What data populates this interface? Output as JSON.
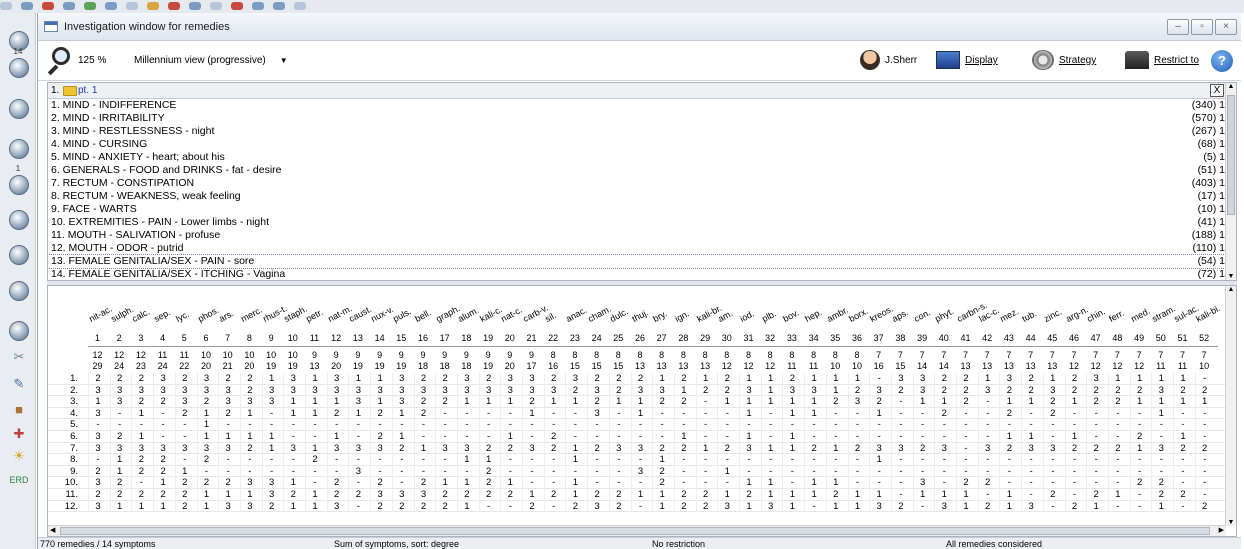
{
  "window": {
    "title": "Investigation window for remedies"
  },
  "sidebar": {
    "numbers": [
      "14",
      "1"
    ]
  },
  "toolbar": {
    "zoom": "125 %",
    "view_mode": "Millennium view (progressive)",
    "author": "J.Sherr",
    "display": "Display",
    "strategy": "Strategy",
    "restrict": "Restrict to",
    "help": "?"
  },
  "rubrics_pane": {
    "header_number": "1.",
    "header_title": "pt. 1",
    "close": "X",
    "items": [
      {
        "label": "1. MIND - INDIFFERENCE",
        "count": "(340) 1"
      },
      {
        "label": "2. MIND - IRRITABILITY",
        "count": "(570) 1"
      },
      {
        "label": "3. MIND - RESTLESSNESS - night",
        "count": "(267) 1"
      },
      {
        "label": "4. MIND - CURSING",
        "count": "(68) 1"
      },
      {
        "label": "5. MIND - ANXIETY - heart; about his",
        "count": "(5) 1"
      },
      {
        "label": "6. GENERALS - FOOD and DRINKS - fat - desire",
        "count": "(51) 1"
      },
      {
        "label": "7. RECTUM - CONSTIPATION",
        "count": "(403) 1"
      },
      {
        "label": "8. RECTUM - WEAKNESS, weak feeling",
        "count": "(17) 1"
      },
      {
        "label": "9. FACE - WARTS",
        "count": "(10) 1"
      },
      {
        "label": "10. EXTREMITIES - PAIN - Lower limbs - night",
        "count": "(41) 1"
      },
      {
        "label": "11. MOUTH - SALIVATION - profuse",
        "count": "(188) 1"
      },
      {
        "label": "12. MOUTH - ODOR - putrid",
        "count": "(110) 1"
      },
      {
        "label": "13. FEMALE GENITALIA/SEX - PAIN - sore",
        "count": "(54) 1"
      },
      {
        "label": "14. FEMALE GENITALIA/SEX - ITCHING - Vagina",
        "count": "(72) 1"
      }
    ]
  },
  "grid": {
    "remedies": [
      "nit-ac.",
      "sulph.",
      "calc.",
      "sep.",
      "lyc.",
      "phos.",
      "ars.",
      "merc.",
      "rhus-t.",
      "staph.",
      "petr.",
      "nat-m.",
      "caust.",
      "nux-v.",
      "puls.",
      "bell.",
      "graph.",
      "alum.",
      "kali-c.",
      "nat-c.",
      "carb-v.",
      "sil.",
      "anac.",
      "cham.",
      "dulc.",
      "thuj.",
      "bry.",
      "ign.",
      "kali-br.",
      "am.",
      "iod.",
      "plb.",
      "bov.",
      "hep.",
      "ambr.",
      "borx.",
      "kreos.",
      "aps.",
      "con.",
      "phyt.",
      "carbn-s.",
      "lac-c.",
      "mez.",
      "tub.",
      "zinc.",
      "arg-n.",
      "chin.",
      "ferr.",
      "med.",
      "stram.",
      "sul-ac.",
      "kali-bi."
    ],
    "indices": [
      "1",
      "2",
      "3",
      "4",
      "5",
      "6",
      "7",
      "8",
      "9",
      "10",
      "11",
      "12",
      "13",
      "14",
      "15",
      "16",
      "17",
      "18",
      "19",
      "20",
      "21",
      "22",
      "23",
      "24",
      "25",
      "26",
      "27",
      "28",
      "29",
      "30",
      "31",
      "32",
      "33",
      "34",
      "35",
      "36",
      "37",
      "38",
      "39",
      "40",
      "41",
      "42",
      "43",
      "44",
      "45",
      "46",
      "47",
      "48",
      "49",
      "50",
      "51",
      "52"
    ],
    "totals_row1": [
      "12",
      "12",
      "12",
      "11",
      "11",
      "10",
      "10",
      "10",
      "10",
      "10",
      "9",
      "9",
      "9",
      "9",
      "9",
      "9",
      "9",
      "9",
      "9",
      "9",
      "9",
      "8",
      "8",
      "8",
      "8",
      "8",
      "8",
      "8",
      "8",
      "8",
      "8",
      "8",
      "8",
      "8",
      "8",
      "8",
      "7",
      "7",
      "7",
      "7",
      "7",
      "7",
      "7",
      "7",
      "7",
      "7",
      "7",
      "7",
      "7",
      "7",
      "7",
      "7"
    ],
    "totals_row2": [
      "29",
      "24",
      "23",
      "24",
      "22",
      "20",
      "21",
      "20",
      "19",
      "19",
      "13",
      "20",
      "19",
      "19",
      "19",
      "18",
      "18",
      "18",
      "19",
      "20",
      "17",
      "16",
      "15",
      "15",
      "15",
      "13",
      "13",
      "13",
      "13",
      "12",
      "12",
      "12",
      "11",
      "11",
      "10",
      "10",
      "16",
      "15",
      "14",
      "14",
      "13",
      "13",
      "13",
      "13",
      "13",
      "12",
      "12",
      "12",
      "12",
      "11",
      "11",
      "10"
    ],
    "rows": [
      {
        "label": "1.",
        "cells": [
          "2",
          "2",
          "2",
          "3",
          "2",
          "3",
          "2",
          "2",
          "1",
          "3",
          "1",
          "3",
          "1",
          "1",
          "3",
          "2",
          "2",
          "3",
          "2",
          "3",
          "3",
          "2",
          "3",
          "2",
          "2",
          "2",
          "1",
          "2",
          "1",
          "2",
          "1",
          "1",
          "2",
          "1",
          "1",
          "1",
          "-",
          "3",
          "3",
          "2",
          "2",
          "1",
          "3",
          "2",
          "1",
          "2",
          "3",
          "1",
          "1",
          "1",
          "1",
          "-"
        ]
      },
      {
        "label": "2.",
        "cells": [
          "3",
          "3",
          "3",
          "3",
          "3",
          "3",
          "3",
          "2",
          "3",
          "3",
          "3",
          "3",
          "3",
          "3",
          "3",
          "3",
          "3",
          "3",
          "3",
          "3",
          "3",
          "3",
          "2",
          "3",
          "2",
          "3",
          "3",
          "1",
          "2",
          "2",
          "3",
          "1",
          "3",
          "3",
          "1",
          "2",
          "3",
          "2",
          "3",
          "2",
          "2",
          "3",
          "2",
          "2",
          "3",
          "2",
          "2",
          "2",
          "2",
          "3",
          "2",
          "2"
        ]
      },
      {
        "label": "3.",
        "cells": [
          "1",
          "3",
          "2",
          "2",
          "3",
          "2",
          "3",
          "3",
          "3",
          "1",
          "1",
          "1",
          "3",
          "1",
          "3",
          "2",
          "2",
          "1",
          "1",
          "1",
          "2",
          "1",
          "1",
          "2",
          "1",
          "1",
          "2",
          "2",
          "-",
          "1",
          "1",
          "1",
          "1",
          "1",
          "2",
          "3",
          "2",
          "-",
          "1",
          "1",
          "2",
          "-",
          "1",
          "1",
          "2",
          "1",
          "2",
          "2",
          "1",
          "1",
          "1",
          "1"
        ]
      },
      {
        "label": "4.",
        "cells": [
          "3",
          "-",
          "1",
          "-",
          "2",
          "1",
          "2",
          "1",
          "-",
          "1",
          "1",
          "2",
          "1",
          "2",
          "1",
          "2",
          "-",
          "-",
          "-",
          "-",
          "1",
          "-",
          "-",
          "3",
          "-",
          "1",
          "-",
          "-",
          "-",
          "-",
          "1",
          "-",
          "1",
          "1",
          "-",
          "-",
          "1",
          "-",
          "-",
          "2",
          "-",
          "-",
          "2",
          "-",
          "2",
          "-",
          "-",
          "-",
          "-",
          "1",
          "-",
          "-"
        ]
      },
      {
        "label": "5.",
        "cells": [
          "-",
          "-",
          "-",
          "-",
          "-",
          "1",
          "-",
          "-",
          "-",
          "-",
          "-",
          "-",
          "-",
          "-",
          "-",
          "-",
          "-",
          "-",
          "-",
          "-",
          "-",
          "-",
          "-",
          "-",
          "-",
          "-",
          "-",
          "-",
          "-",
          "-",
          "-",
          "-",
          "-",
          "-",
          "-",
          "-",
          "-",
          "-",
          "-",
          "-",
          "-",
          "-",
          "-",
          "-",
          "-",
          "-",
          "-",
          "-",
          "-",
          "-",
          "-",
          "-"
        ]
      },
      {
        "label": "6.",
        "cells": [
          "3",
          "2",
          "1",
          "-",
          "-",
          "1",
          "1",
          "1",
          "1",
          "-",
          "-",
          "1",
          "-",
          "2",
          "1",
          "-",
          "-",
          "-",
          "-",
          "1",
          "-",
          "2",
          "-",
          "-",
          "-",
          "-",
          "-",
          "1",
          "-",
          "-",
          "1",
          "-",
          "1",
          "-",
          "-",
          "-",
          "-",
          "-",
          "-",
          "-",
          "-",
          "-",
          "1",
          "1",
          "-",
          "1",
          "-",
          "-",
          "2",
          "-",
          "1",
          "-"
        ]
      },
      {
        "label": "7.",
        "cells": [
          "3",
          "3",
          "3",
          "3",
          "3",
          "3",
          "3",
          "2",
          "1",
          "3",
          "1",
          "3",
          "3",
          "3",
          "2",
          "1",
          "3",
          "3",
          "2",
          "2",
          "3",
          "2",
          "1",
          "2",
          "3",
          "3",
          "2",
          "2",
          "1",
          "2",
          "3",
          "1",
          "1",
          "2",
          "1",
          "2",
          "3",
          "3",
          "2",
          "3",
          "-",
          "3",
          "2",
          "3",
          "3",
          "2",
          "2",
          "2",
          "1",
          "3",
          "2",
          "2"
        ]
      },
      {
        "label": "8.",
        "cells": [
          "-",
          "1",
          "2",
          "2",
          "-",
          "2",
          "-",
          "-",
          "-",
          "-",
          "2",
          "-",
          "-",
          "-",
          "-",
          "-",
          "-",
          "1",
          "1",
          "-",
          "-",
          "-",
          "1",
          "-",
          "-",
          "-",
          "1",
          "-",
          "-",
          "-",
          "-",
          "-",
          "-",
          "-",
          "-",
          "-",
          "1",
          "-",
          "-",
          "-",
          "-",
          "-",
          "-",
          "-",
          "-",
          "-",
          "-",
          "-",
          "-",
          "-",
          "-",
          "-"
        ]
      },
      {
        "label": "9.",
        "cells": [
          "2",
          "1",
          "2",
          "2",
          "1",
          "-",
          "-",
          "-",
          "-",
          "-",
          "-",
          "-",
          "3",
          "-",
          "-",
          "-",
          "-",
          "-",
          "2",
          "-",
          "-",
          "-",
          "-",
          "-",
          "-",
          "3",
          "2",
          "-",
          "-",
          "1",
          "-",
          "-",
          "-",
          "-",
          "-",
          "-",
          "-",
          "-",
          "-",
          "-",
          "-",
          "-",
          "-",
          "-",
          "-",
          "-",
          "-",
          "-",
          "-",
          "-",
          "-",
          "-"
        ]
      },
      {
        "label": "10.",
        "cells": [
          "3",
          "2",
          "-",
          "1",
          "2",
          "2",
          "2",
          "3",
          "3",
          "1",
          "-",
          "2",
          "-",
          "2",
          "-",
          "2",
          "1",
          "1",
          "2",
          "1",
          "-",
          "-",
          "1",
          "-",
          "-",
          "-",
          "2",
          "-",
          "-",
          "-",
          "1",
          "1",
          "-",
          "1",
          "1",
          "-",
          "-",
          "-",
          "3",
          "-",
          "2",
          "2",
          "-",
          "-",
          "-",
          "-",
          "-",
          "-",
          "2",
          "2",
          "-",
          "-"
        ]
      },
      {
        "label": "11.",
        "cells": [
          "2",
          "2",
          "2",
          "2",
          "2",
          "1",
          "1",
          "1",
          "3",
          "2",
          "1",
          "2",
          "2",
          "3",
          "3",
          "3",
          "2",
          "2",
          "2",
          "2",
          "1",
          "2",
          "1",
          "2",
          "2",
          "1",
          "1",
          "2",
          "2",
          "1",
          "2",
          "1",
          "1",
          "1",
          "2",
          "1",
          "1",
          "-",
          "1",
          "1",
          "1",
          "-",
          "1",
          "-",
          "2",
          "-",
          "2",
          "1",
          "-",
          "2",
          "2",
          "-"
        ]
      },
      {
        "label": "12.",
        "cells": [
          "3",
          "1",
          "1",
          "1",
          "2",
          "1",
          "3",
          "3",
          "2",
          "1",
          "1",
          "3",
          "-",
          "2",
          "2",
          "2",
          "2",
          "1",
          "-",
          "-",
          "2",
          "-",
          "2",
          "3",
          "2",
          "-",
          "1",
          "2",
          "2",
          "3",
          "1",
          "3",
          "1",
          "-",
          "1",
          "1",
          "3",
          "2",
          "-",
          "3",
          "1",
          "2",
          "1",
          "3",
          "-",
          "2",
          "1",
          "-",
          "-",
          "1",
          "-",
          "2"
        ]
      }
    ]
  },
  "status": {
    "remedies": "770 remedies / 14 symptoms",
    "sort": "Sum of symptoms, sort: degree",
    "restriction": "No restriction",
    "considered": "All remedies considered"
  }
}
